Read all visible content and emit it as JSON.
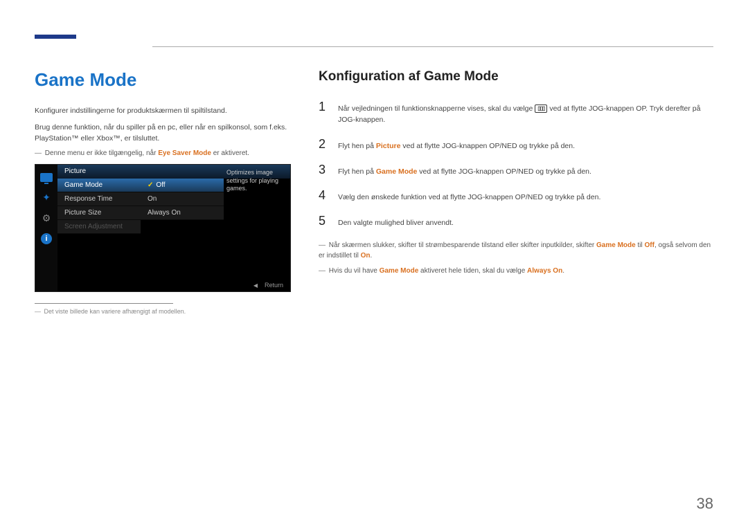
{
  "left": {
    "heading": "Game Mode",
    "p1": "Konfigurer indstillingerne for produktskærmen til spiltilstand.",
    "p2": "Brug denne funktion, når du spiller på en pc, eller når en spilkonsol, som f.eks. PlayStation™ eller Xbox™, er tilsluttet.",
    "note_prefix": "Denne menu er ikke tilgængelig, når ",
    "note_bold": "Eye Saver Mode",
    "note_suffix": " er aktiveret."
  },
  "osd": {
    "header": "Picture",
    "items": [
      "Game Mode",
      "Response Time",
      "Picture Size",
      "Screen Adjustment"
    ],
    "sub": [
      "Off",
      "On",
      "Always On"
    ],
    "desc": "Optimizes image settings for playing games.",
    "return": "Return"
  },
  "footnote": "Det viste billede kan variere afhængigt af modellen.",
  "right": {
    "heading": "Konfiguration af Game Mode",
    "steps": {
      "s1a": "Når vejledningen til funktionsknapperne vises, skal du vælge ",
      "s1b": " ved at flytte JOG-knappen OP. Tryk derefter på JOG-knappen.",
      "s2a": "Flyt hen på ",
      "s2_bold": "Picture",
      "s2b": " ved at flytte JOG-knappen OP/NED og trykke på den.",
      "s3a": "Flyt hen på ",
      "s3_bold": "Game Mode",
      "s3b": " ved at flytte JOG-knappen OP/NED og trykke på den.",
      "s4": "Vælg den ønskede funktion ved at flytte JOG-knappen OP/NED og trykke på den.",
      "s5": "Den valgte mulighed bliver anvendt."
    },
    "post1a": "Når skærmen slukker, skifter til strømbesparende tilstand eller skifter inputkilder, skifter ",
    "post1_b1": "Game Mode",
    "post1b": " til ",
    "post1_b2": "Off",
    "post1c": ", også selvom den er indstillet til ",
    "post1_b3": "On",
    "post1d": ".",
    "post2a": "Hvis du vil have ",
    "post2_b1": "Game Mode",
    "post2b": " aktiveret hele tiden, skal du vælge ",
    "post2_b2": "Always On",
    "post2c": "."
  },
  "page": "38"
}
